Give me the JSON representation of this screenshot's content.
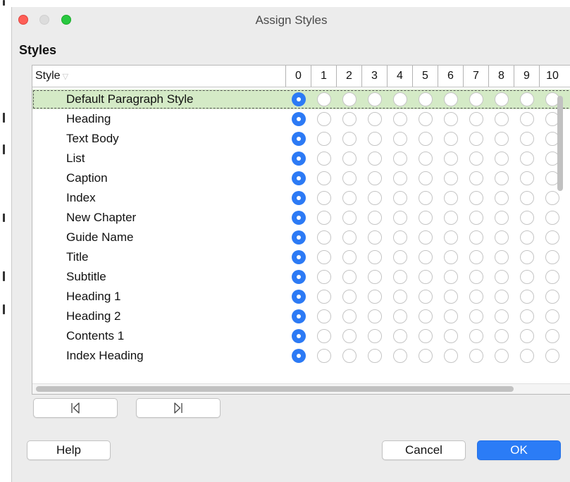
{
  "window": {
    "title": "Assign Styles"
  },
  "section": {
    "heading": "Styles"
  },
  "table": {
    "style_header": "Style",
    "levels": [
      "0",
      "1",
      "2",
      "3",
      "4",
      "5",
      "6",
      "7",
      "8",
      "9",
      "10"
    ],
    "rows": [
      {
        "label": "Default Paragraph Style",
        "level": 0,
        "selected": true
      },
      {
        "label": "Heading",
        "level": 0
      },
      {
        "label": "Text Body",
        "level": 0
      },
      {
        "label": "List",
        "level": 0
      },
      {
        "label": "Caption",
        "level": 0
      },
      {
        "label": "Index",
        "level": 0
      },
      {
        "label": "New Chapter",
        "level": 0
      },
      {
        "label": "Guide Name",
        "level": 0
      },
      {
        "label": "Title",
        "level": 0
      },
      {
        "label": "Subtitle",
        "level": 0
      },
      {
        "label": "Heading 1",
        "level": 0
      },
      {
        "label": "Heading 2",
        "level": 0
      },
      {
        "label": "Contents 1",
        "level": 0
      },
      {
        "label": "Index Heading",
        "level": 0
      }
    ]
  },
  "nav": {
    "left_icon": "move-left-icon",
    "right_icon": "move-right-icon"
  },
  "buttons": {
    "help": "Help",
    "cancel": "Cancel",
    "ok": "OK"
  },
  "colors": {
    "accent": "#2c7af5",
    "selection": "#d4eac6",
    "ok_button": "#2b7cf6"
  }
}
